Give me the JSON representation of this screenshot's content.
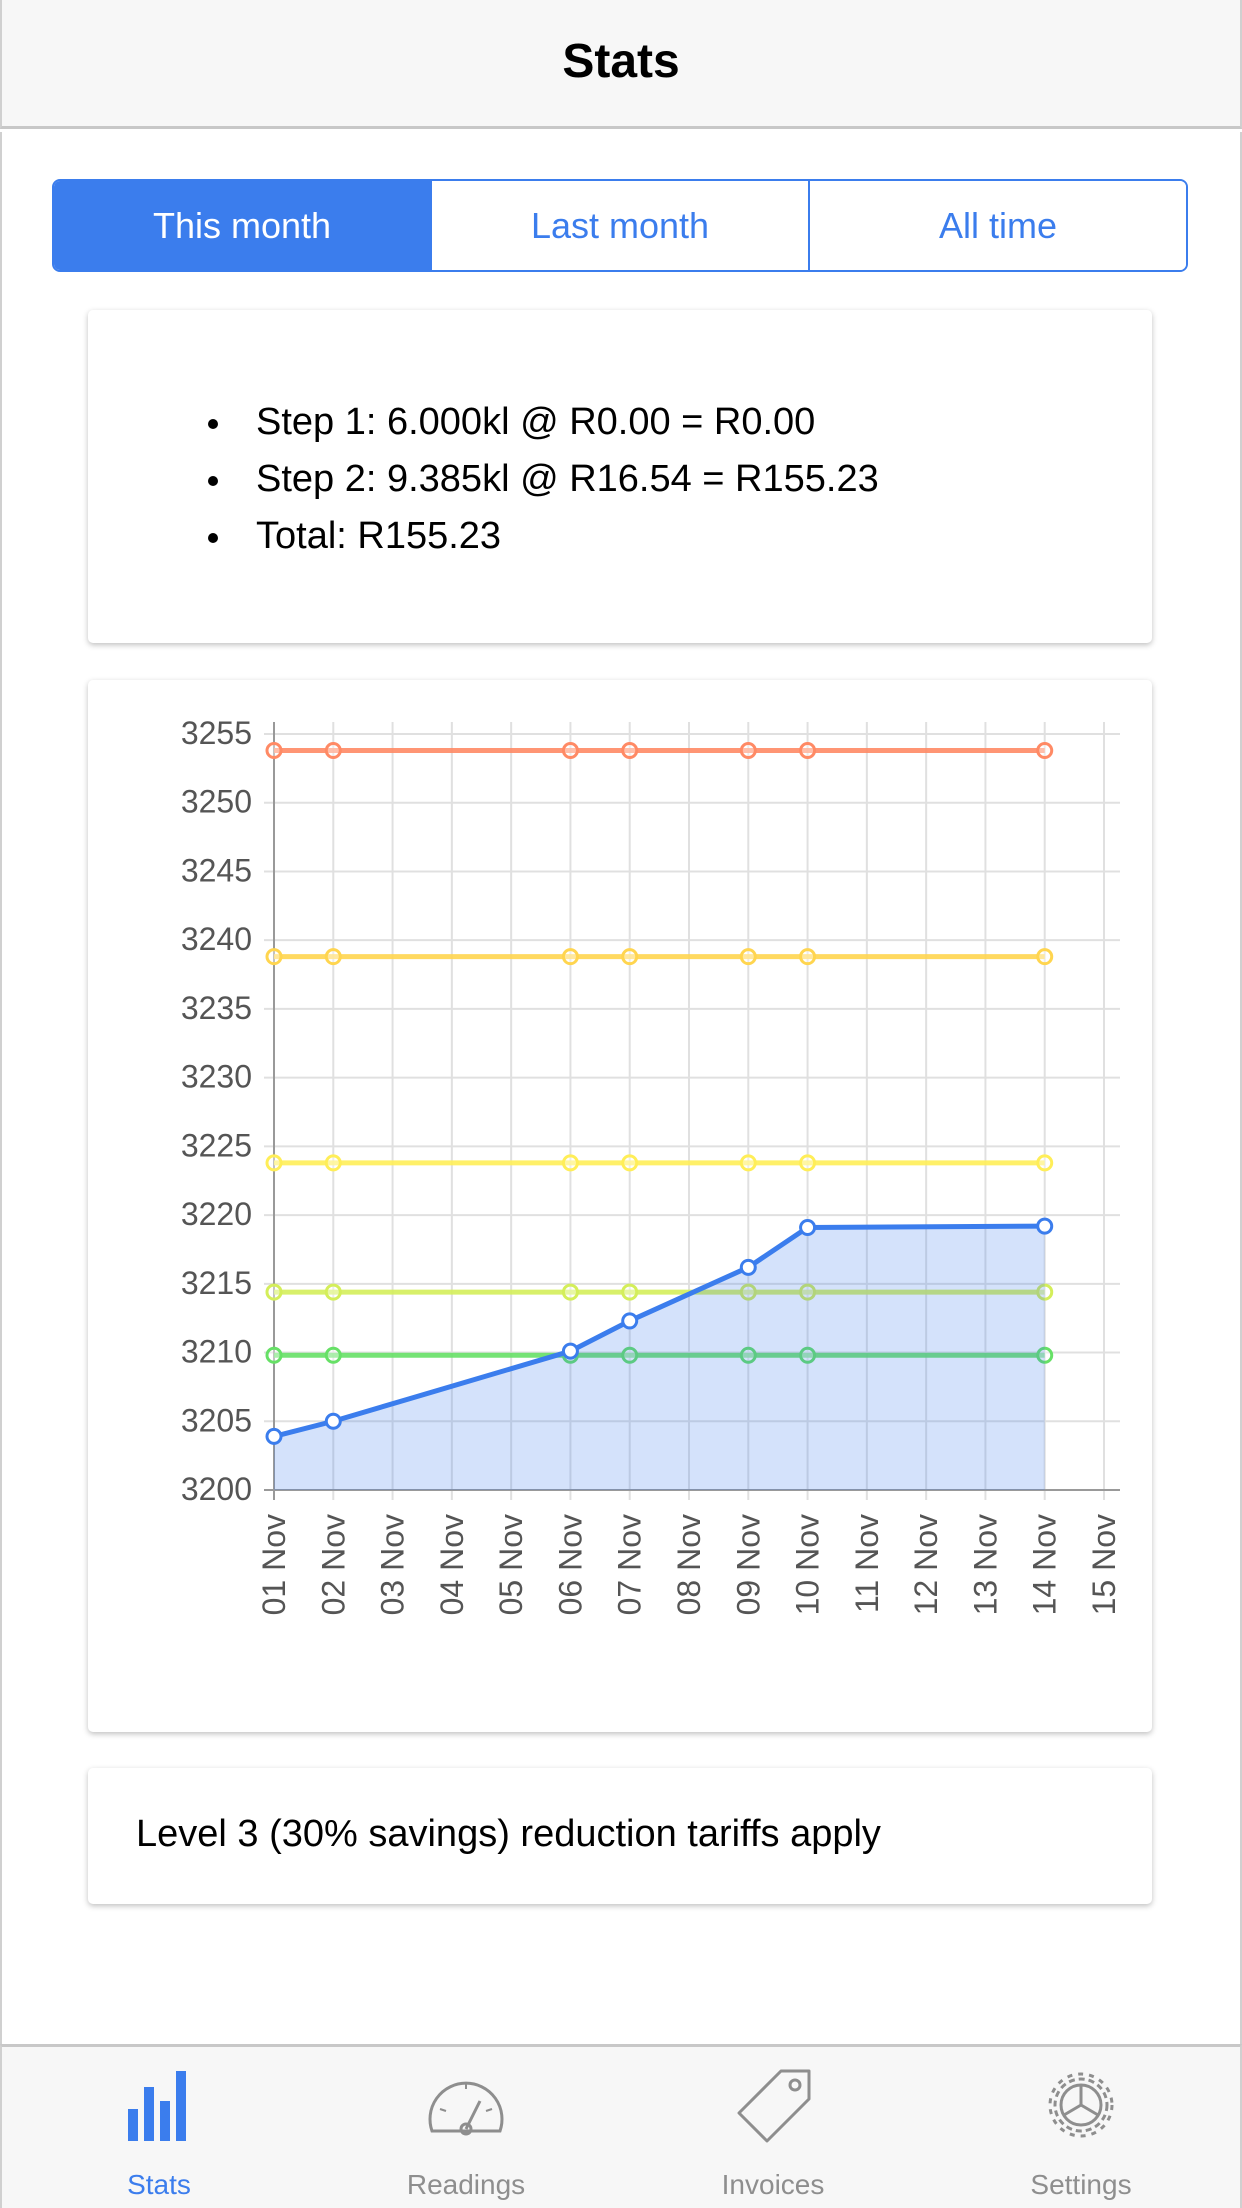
{
  "header": {
    "title": "Stats"
  },
  "period_tabs": [
    {
      "label": "This month",
      "active": true
    },
    {
      "label": "Last month",
      "active": false
    },
    {
      "label": "All time",
      "active": false
    }
  ],
  "tariff_steps": [
    "Step 1: 6.000kl @ R0.00 = R0.00",
    "Step 2: 9.385kl @ R16.54 = R155.23",
    "Total: R155.23"
  ],
  "note": "Level 3 (30% savings) reduction tariffs apply",
  "tabbar": [
    {
      "label": "Stats",
      "icon": "bar-chart-icon",
      "active": true
    },
    {
      "label": "Readings",
      "icon": "gauge-icon",
      "active": false
    },
    {
      "label": "Invoices",
      "icon": "tag-icon",
      "active": false
    },
    {
      "label": "Settings",
      "icon": "gear-icon",
      "active": false
    }
  ],
  "colors": {
    "accent": "#3b7ded"
  },
  "chart_data": {
    "type": "line",
    "x": [
      "01 Nov",
      "02 Nov",
      "03 Nov",
      "04 Nov",
      "05 Nov",
      "06 Nov",
      "07 Nov",
      "08 Nov",
      "09 Nov",
      "10 Nov",
      "11 Nov",
      "12 Nov",
      "13 Nov",
      "14 Nov",
      "15 Nov"
    ],
    "ylim": [
      3200,
      3255
    ],
    "yticks": [
      3200,
      3205,
      3210,
      3215,
      3220,
      3225,
      3230,
      3235,
      3240,
      3245,
      3250,
      3255
    ],
    "grid": true,
    "series": [
      {
        "color": "#ff8a65",
        "points": [
          [
            "01 Nov",
            3253.8
          ],
          [
            "02 Nov",
            3253.8
          ],
          [
            "06 Nov",
            3253.8
          ],
          [
            "07 Nov",
            3253.8
          ],
          [
            "09 Nov",
            3253.8
          ],
          [
            "10 Nov",
            3253.8
          ],
          [
            "14 Nov",
            3253.8
          ]
        ]
      },
      {
        "color": "#ffd54f",
        "points": [
          [
            "01 Nov",
            3238.8
          ],
          [
            "02 Nov",
            3238.8
          ],
          [
            "06 Nov",
            3238.8
          ],
          [
            "07 Nov",
            3238.8
          ],
          [
            "09 Nov",
            3238.8
          ],
          [
            "10 Nov",
            3238.8
          ],
          [
            "14 Nov",
            3238.8
          ]
        ]
      },
      {
        "color": "#ffee58",
        "points": [
          [
            "01 Nov",
            3223.8
          ],
          [
            "02 Nov",
            3223.8
          ],
          [
            "06 Nov",
            3223.8
          ],
          [
            "07 Nov",
            3223.8
          ],
          [
            "09 Nov",
            3223.8
          ],
          [
            "10 Nov",
            3223.8
          ],
          [
            "14 Nov",
            3223.8
          ]
        ]
      },
      {
        "color": "#d4ee5a",
        "points": [
          [
            "01 Nov",
            3214.4
          ],
          [
            "02 Nov",
            3214.4
          ],
          [
            "06 Nov",
            3214.4
          ],
          [
            "07 Nov",
            3214.4
          ],
          [
            "09 Nov",
            3214.4
          ],
          [
            "10 Nov",
            3214.4
          ],
          [
            "14 Nov",
            3214.4
          ]
        ]
      },
      {
        "color": "#66e066",
        "points": [
          [
            "01 Nov",
            3209.8
          ],
          [
            "02 Nov",
            3209.8
          ],
          [
            "06 Nov",
            3209.8
          ],
          [
            "07 Nov",
            3209.8
          ],
          [
            "09 Nov",
            3209.8
          ],
          [
            "10 Nov",
            3209.8
          ],
          [
            "14 Nov",
            3209.8
          ]
        ]
      },
      {
        "color": "#3b7ded",
        "fill": true,
        "points": [
          [
            "01 Nov",
            3203.9
          ],
          [
            "02 Nov",
            3205.0
          ],
          [
            "06 Nov",
            3210.1
          ],
          [
            "07 Nov",
            3212.3
          ],
          [
            "09 Nov",
            3216.2
          ],
          [
            "10 Nov",
            3219.1
          ],
          [
            "14 Nov",
            3219.2
          ]
        ]
      }
    ]
  }
}
